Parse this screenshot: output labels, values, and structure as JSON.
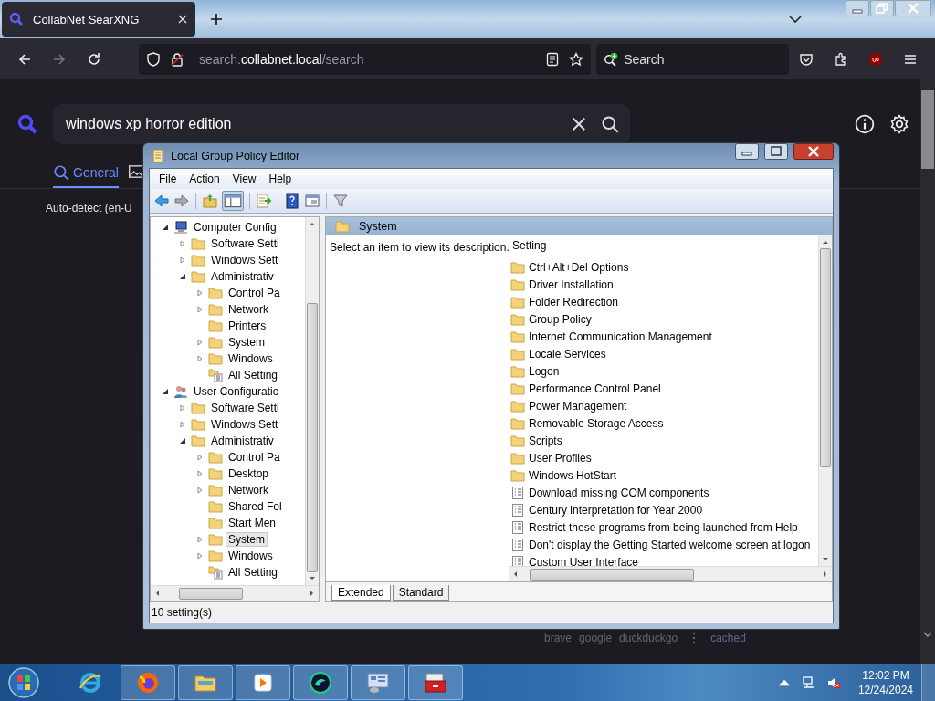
{
  "browser": {
    "tab_title": "CollabNet SearXNG",
    "url": {
      "prefix": "search.",
      "domain": "collabnet.local",
      "path": "/search"
    },
    "search_placeholder": "Search"
  },
  "page": {
    "query": "windows xp horror edition",
    "categories": [
      {
        "label": "General",
        "selected": true
      }
    ],
    "language": "Auto-detect (en-U",
    "engines": [
      "brave",
      "google",
      "duckduckgo"
    ],
    "cached": "cached"
  },
  "gpo": {
    "title": "Local Group Policy Editor",
    "menu": [
      "File",
      "Action",
      "View",
      "Help"
    ],
    "tree": [
      {
        "label": "Computer Config",
        "kind": "computer",
        "expanded": true,
        "selected": false,
        "children": [
          {
            "label": "Software Setti",
            "kind": "folder",
            "expanded": false,
            "selected": false
          },
          {
            "label": "Windows Sett",
            "kind": "folder",
            "expanded": false,
            "selected": false
          },
          {
            "label": "Administrativ",
            "kind": "folder",
            "expanded": true,
            "selected": false,
            "children": [
              {
                "label": "Control Pa",
                "kind": "folder",
                "expanded": false,
                "selected": false
              },
              {
                "label": "Network",
                "kind": "folder",
                "expanded": false,
                "selected": false
              },
              {
                "label": "Printers",
                "kind": "folder",
                "selected": false
              },
              {
                "label": "System",
                "kind": "folder",
                "expanded": false,
                "selected": false
              },
              {
                "label": "Windows",
                "kind": "folder",
                "expanded": false,
                "selected": false
              },
              {
                "label": "All Setting",
                "kind": "all-settings",
                "selected": false
              }
            ]
          }
        ]
      },
      {
        "label": "User Configuratio",
        "kind": "user",
        "expanded": true,
        "selected": false,
        "children": [
          {
            "label": "Software Setti",
            "kind": "folder",
            "expanded": false,
            "selected": false
          },
          {
            "label": "Windows Sett",
            "kind": "folder",
            "expanded": false,
            "selected": false
          },
          {
            "label": "Administrativ",
            "kind": "folder",
            "expanded": true,
            "selected": false,
            "children": [
              {
                "label": "Control Pa",
                "kind": "folder",
                "expanded": false,
                "selected": false
              },
              {
                "label": "Desktop",
                "kind": "folder",
                "expanded": false,
                "selected": false
              },
              {
                "label": "Network",
                "kind": "folder",
                "expanded": false,
                "selected": false
              },
              {
                "label": "Shared Fol",
                "kind": "folder",
                "selected": false
              },
              {
                "label": "Start Men",
                "kind": "folder",
                "selected": false
              },
              {
                "label": "System",
                "kind": "folder",
                "expanded": false,
                "selected": true
              },
              {
                "label": "Windows",
                "kind": "folder",
                "expanded": false,
                "selected": false
              },
              {
                "label": "All Setting",
                "kind": "all-settings",
                "selected": false
              }
            ]
          }
        ]
      }
    ],
    "header": "System",
    "description": "Select an item to view its description.",
    "column": "Setting",
    "settings": [
      {
        "kind": "folder",
        "label": "Ctrl+Alt+Del Options"
      },
      {
        "kind": "folder",
        "label": "Driver Installation"
      },
      {
        "kind": "folder",
        "label": "Folder Redirection"
      },
      {
        "kind": "folder",
        "label": "Group Policy"
      },
      {
        "kind": "folder",
        "label": "Internet Communication Management"
      },
      {
        "kind": "folder",
        "label": "Locale Services"
      },
      {
        "kind": "folder",
        "label": "Logon"
      },
      {
        "kind": "folder",
        "label": "Performance Control Panel"
      },
      {
        "kind": "folder",
        "label": "Power Management"
      },
      {
        "kind": "folder",
        "label": "Removable Storage Access"
      },
      {
        "kind": "folder",
        "label": "Scripts"
      },
      {
        "kind": "folder",
        "label": "User Profiles"
      },
      {
        "kind": "folder",
        "label": "Windows HotStart"
      },
      {
        "kind": "policy",
        "label": "Download missing COM components"
      },
      {
        "kind": "policy",
        "label": "Century interpretation for Year 2000"
      },
      {
        "kind": "policy",
        "label": "Restrict these programs from being launched from Help"
      },
      {
        "kind": "policy",
        "label": "Don't display the Getting Started welcome screen at logon"
      },
      {
        "kind": "policy",
        "label": "Custom User Interface"
      }
    ],
    "view_tabs": [
      {
        "label": "Extended",
        "selected": true
      },
      {
        "label": "Standard",
        "selected": false
      }
    ],
    "status": "10 setting(s)"
  },
  "taskbar": {
    "apps": [
      {
        "kind": "ie",
        "running": false
      },
      {
        "kind": "firefox",
        "running": true
      },
      {
        "kind": "explorer",
        "running": true
      },
      {
        "kind": "media",
        "running": true
      },
      {
        "kind": "green-app",
        "running": true
      },
      {
        "kind": "control-panel",
        "running": true
      },
      {
        "kind": "toolbox",
        "running": true
      }
    ],
    "time": "12:02 PM",
    "date": "12/24/2024"
  }
}
